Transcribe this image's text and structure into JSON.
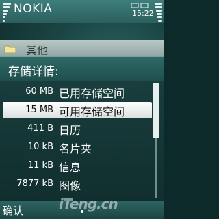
{
  "statusbar": {
    "title": "NOKIA",
    "time": "15:22",
    "signal_icon": "signal-strength-icon",
    "battery_icon": "battery-level-icon"
  },
  "background_list": {
    "folder_label": "其他",
    "folder_icon": "folder-icon"
  },
  "popup": {
    "title": "存储详情:",
    "rows": [
      {
        "size": "60 MB",
        "name": "已用存储空间"
      },
      {
        "size": "15 MB",
        "name": "可用存储空间"
      },
      {
        "size": "411 B",
        "name": "日历"
      },
      {
        "size": "10 kB",
        "name": "名片夹"
      },
      {
        "size": "11 kB",
        "name": "信息"
      },
      {
        "size": "7877 kB",
        "name": "图像"
      }
    ],
    "selected_index": 1
  },
  "softkeys": {
    "left": "确认"
  },
  "watermark": "iTeng.cn",
  "colors": {
    "status_bar": "#3e7e7c",
    "popup_bg": "#1a403f",
    "selected_row": "#ffffff",
    "text": "#ffffff"
  }
}
